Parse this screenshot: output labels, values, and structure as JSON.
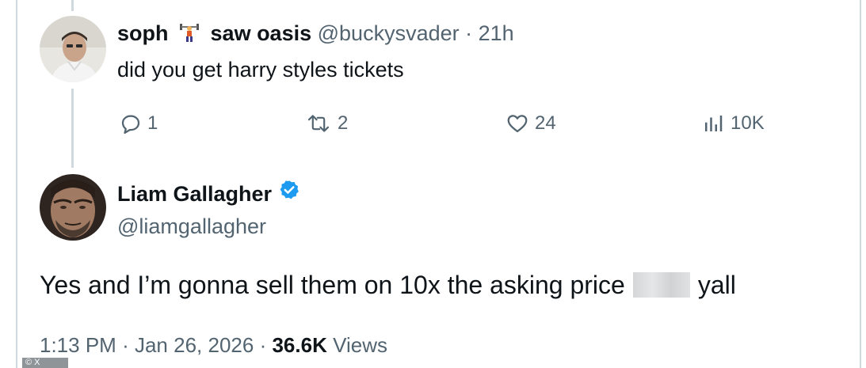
{
  "reply_tweet": {
    "display_name": "soph",
    "name_suffix": "saw oasis",
    "handle": "@buckysvader",
    "separator": "·",
    "time_ago": "21h",
    "text": "did you get harry styles tickets",
    "actions": {
      "reply_count": "1",
      "retweet_count": "2",
      "like_count": "24",
      "views_count": "10K"
    }
  },
  "main_tweet": {
    "display_name": "Liam Gallagher",
    "handle": "@liamgallagher",
    "text_before": "Yes and I’m gonna sell them on 10x the asking price",
    "text_after": "yall",
    "time": "1:13 PM",
    "sep1": "·",
    "date": "Jan 26, 2026",
    "sep2": "·",
    "views_count": "36.6K",
    "views_label": "Views"
  },
  "watermark_text": "© X",
  "colors": {
    "text_primary": "#0f1419",
    "text_secondary": "#536471",
    "verified_blue": "#1d9bf0",
    "thread_line": "#cfd9de"
  },
  "icons": {
    "reply": "speech-bubble-icon",
    "retweet": "retweet-icon",
    "like": "heart-icon",
    "views": "bar-chart-icon",
    "verified": "verified-badge-icon"
  }
}
